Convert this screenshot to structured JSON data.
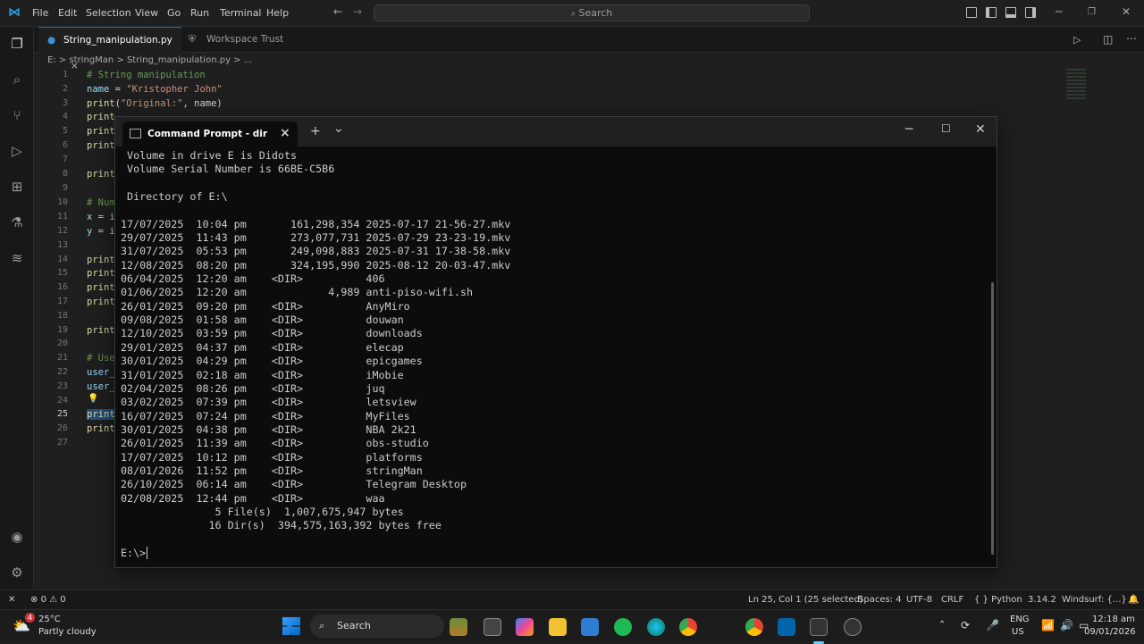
{
  "vscode": {
    "menu": [
      "File",
      "Edit",
      "Selection",
      "View",
      "Go",
      "Run",
      "Terminal",
      "Help"
    ],
    "search_placeholder": "Search",
    "tabs": [
      {
        "label": "String_manipulation.py",
        "close": "×"
      },
      {
        "label": "Workspace Trust"
      }
    ],
    "breadcrumb": "E: > stringMan > String_manipulation.py > ...",
    "line_numbers": [
      "1",
      "2",
      "3",
      "4",
      "5",
      "6",
      "7",
      "8",
      "9",
      "10",
      "11",
      "12",
      "13",
      "14",
      "15",
      "16",
      "17",
      "18",
      "19",
      "20",
      "21",
      "22",
      "23",
      "24",
      "25",
      "26",
      "27"
    ],
    "code": {
      "l1": "# String manipulation",
      "l2_var": "name",
      "l2_rest": " = ",
      "l2_str": "\"Kristopher John\"",
      "l3_fn": "print",
      "l3_open": "(",
      "l3_str": "\"Original:\"",
      "l3_rest": ", name)",
      "l4": "print",
      "l5": "print",
      "l6": "print",
      "l8": "print",
      "l10": "# Num",
      "l11": "x = i",
      "l12": "y = i",
      "l14": "print",
      "l15": "print",
      "l16": "print",
      "l17": "print",
      "l19": "print",
      "l21": "# Use",
      "l22": "user_",
      "l23": "user_",
      "l25": "print",
      "l26": "print"
    },
    "status": {
      "errors": "0",
      "warnings": "0",
      "position": "Ln 25, Col 1 (25 selected)",
      "spaces": "Spaces: 4",
      "encoding": "UTF-8",
      "eol": "CRLF",
      "language": "{ } Python",
      "version": "3.14.2",
      "extension": "Windsurf: {...}"
    }
  },
  "terminal": {
    "tab_title": "Command Prompt - dir",
    "close": "×",
    "new_tab": "+",
    "dropdown": "⌄",
    "lines": [
      " Volume in drive E is Didots",
      " Volume Serial Number is 66BE-C5B6",
      "",
      " Directory of E:\\",
      "",
      "17/07/2025  10:04 pm       161,298,354 2025-07-17 21-56-27.mkv",
      "29/07/2025  11:43 pm       273,077,731 2025-07-29 23-23-19.mkv",
      "31/07/2025  05:53 pm       249,098,883 2025-07-31 17-38-58.mkv",
      "12/08/2025  08:20 pm       324,195,990 2025-08-12 20-03-47.mkv",
      "06/04/2025  12:20 am    <DIR>          406",
      "01/06/2025  12:20 am             4,989 anti-piso-wifi.sh",
      "26/01/2025  09:20 pm    <DIR>          AnyMiro",
      "09/08/2025  01:58 am    <DIR>          douwan",
      "12/10/2025  03:59 pm    <DIR>          downloads",
      "29/01/2025  04:37 pm    <DIR>          elecap",
      "30/01/2025  04:29 pm    <DIR>          epicgames",
      "31/01/2025  02:18 am    <DIR>          iMobie",
      "02/04/2025  08:26 pm    <DIR>          juq",
      "03/02/2025  07:39 pm    <DIR>          letsview",
      "16/07/2025  07:24 pm    <DIR>          MyFiles",
      "30/01/2025  04:38 pm    <DIR>          NBA 2k21",
      "26/01/2025  11:39 am    <DIR>          obs-studio",
      "17/07/2025  10:12 pm    <DIR>          platforms",
      "08/01/2026  11:52 pm    <DIR>          stringMan",
      "26/10/2025  06:14 am    <DIR>          Telegram Desktop",
      "02/08/2025  12:44 pm    <DIR>          waa",
      "               5 File(s)  1,007,675,947 bytes",
      "              16 Dir(s)  394,575,163,392 bytes free",
      "",
      "E:\\>"
    ]
  },
  "taskbar": {
    "weather_temp": "25°C",
    "weather_desc": "Partly cloudy",
    "search_label": "Search",
    "lang1": "ENG",
    "lang2": "US",
    "time": "12:18 am",
    "date": "09/01/2026",
    "badge": "4"
  },
  "colors": {
    "accent": "#0078d4",
    "terminal_bg": "#0c0c0c",
    "editor_bg": "#1f1f1f"
  }
}
